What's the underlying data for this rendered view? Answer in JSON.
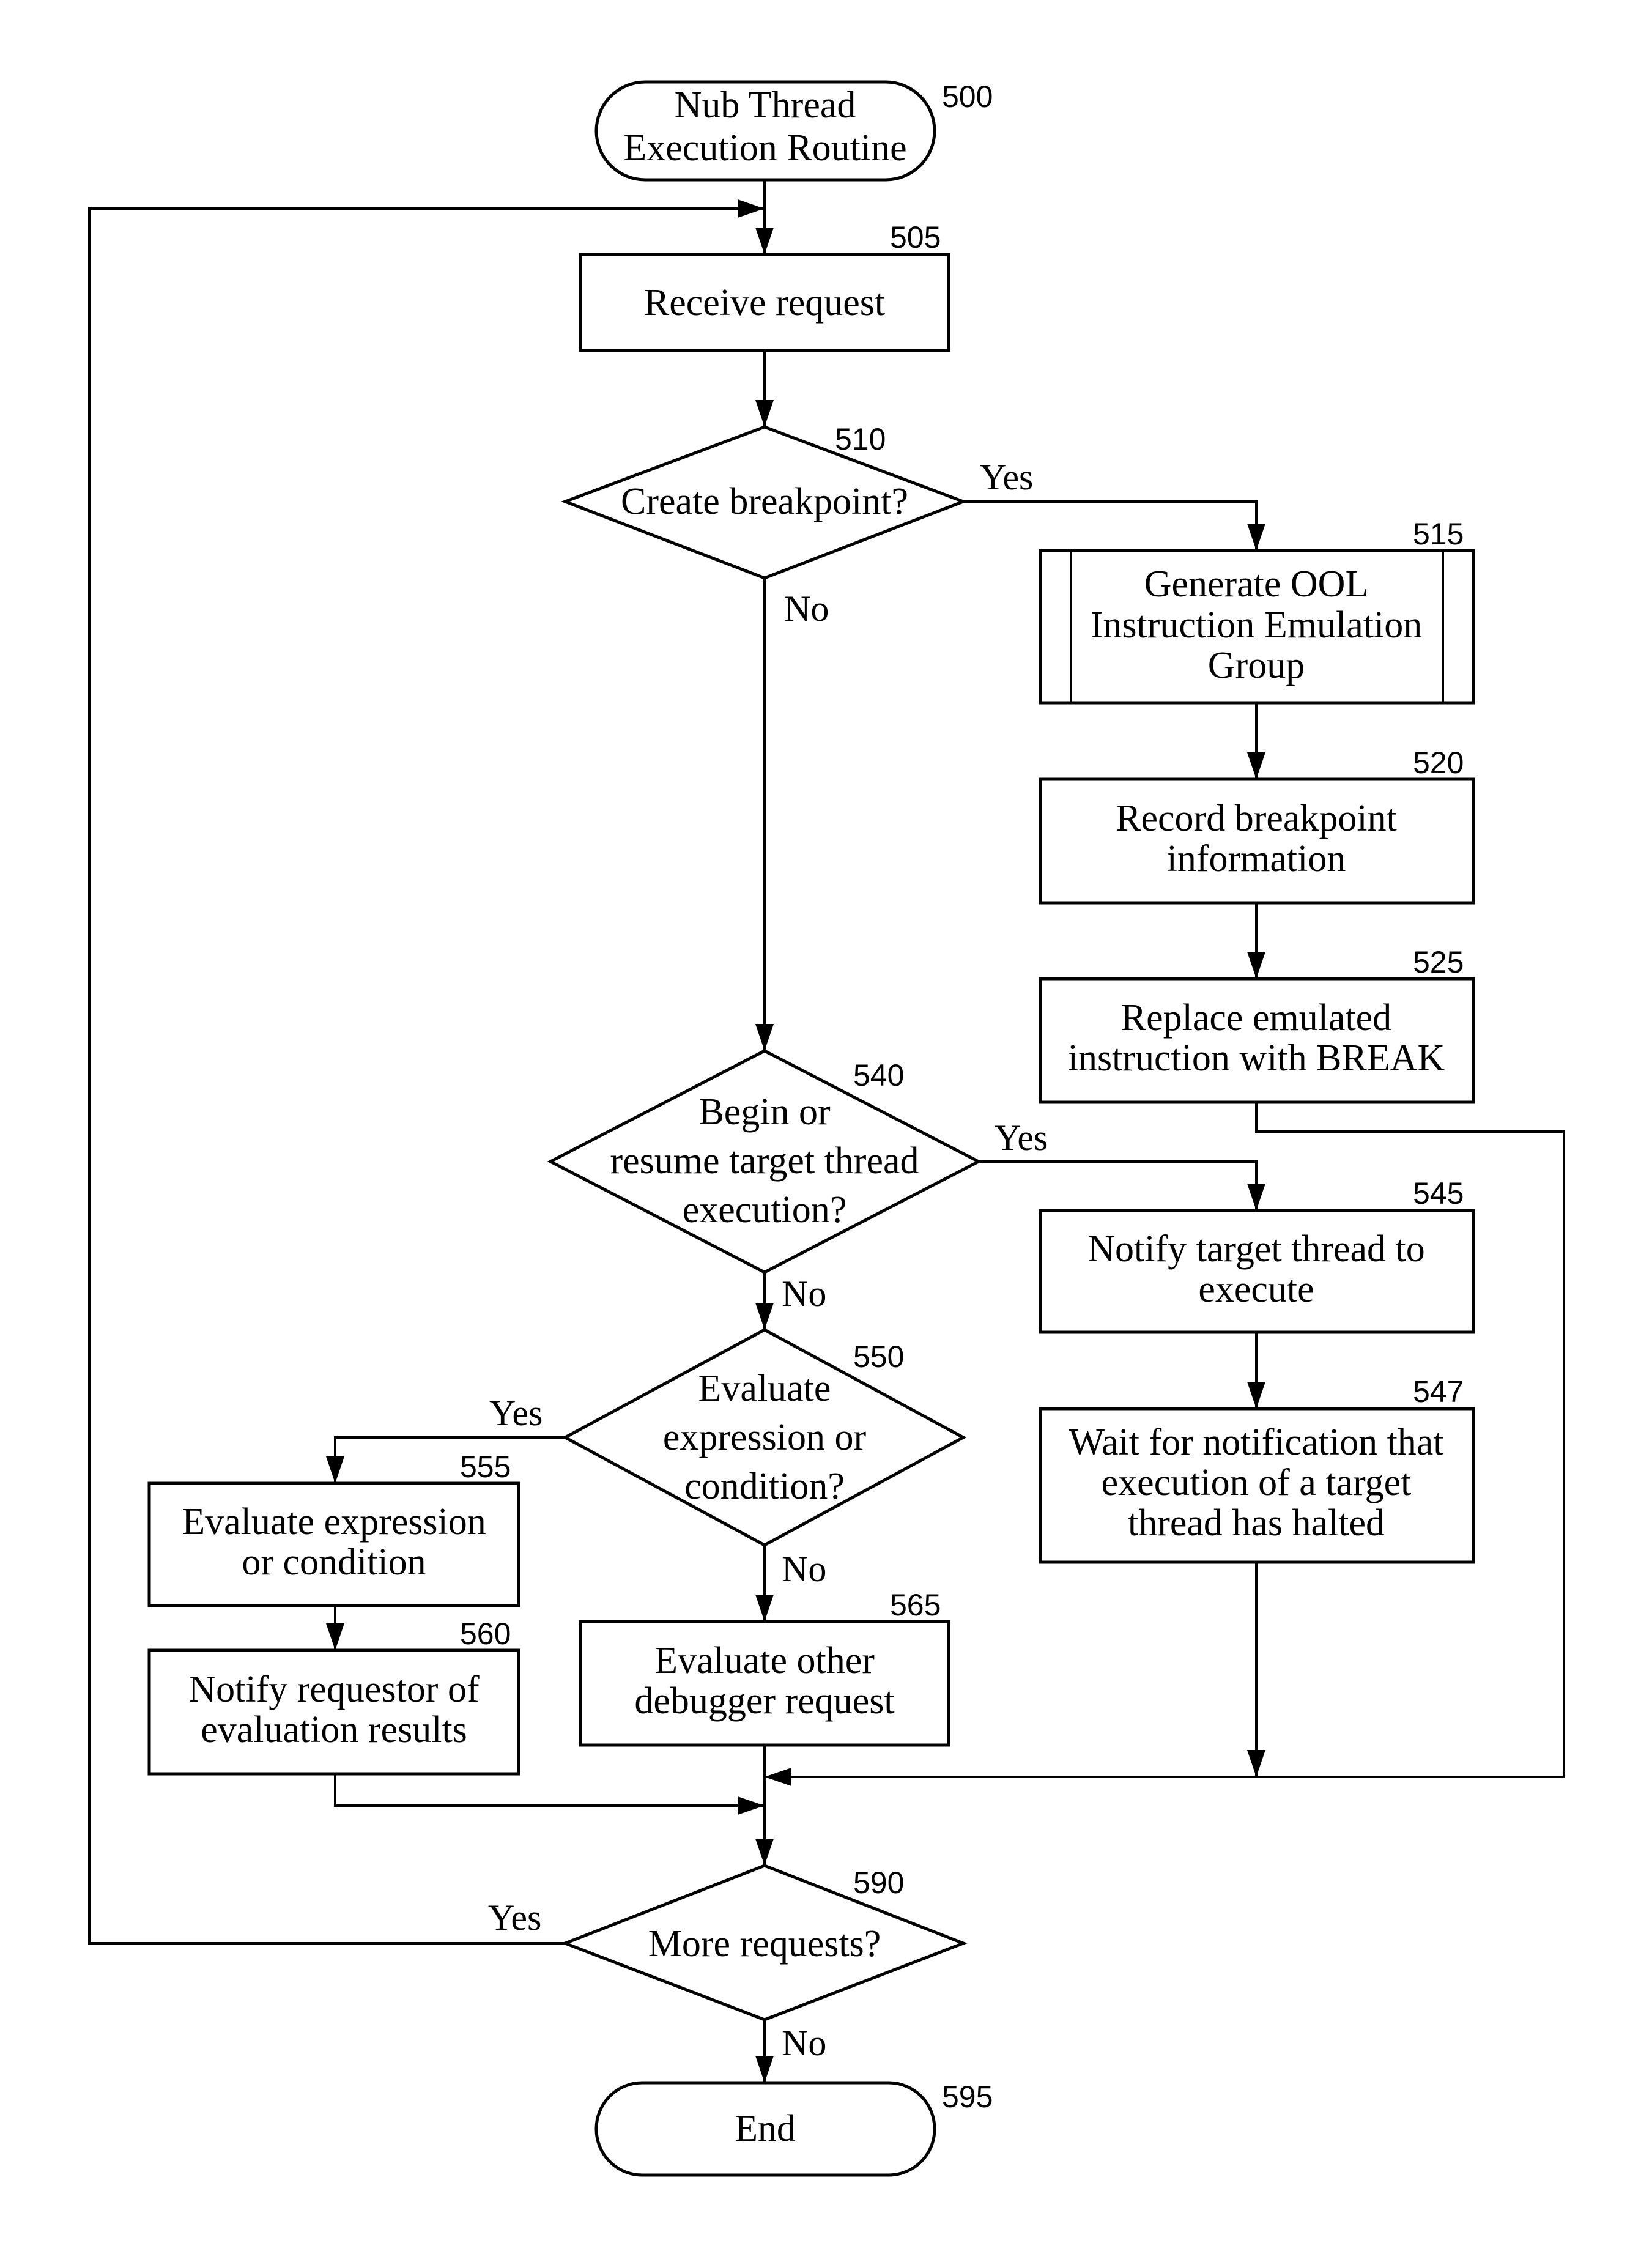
{
  "figure": {
    "nodes": {
      "n500": {
        "ref": "500",
        "type": "terminal",
        "lines": [
          "Nub Thread",
          "Execution Routine"
        ]
      },
      "n505": {
        "ref": "505",
        "type": "process",
        "lines": [
          "Receive request"
        ]
      },
      "n510": {
        "ref": "510",
        "type": "decision",
        "lines": [
          "Create breakpoint?"
        ]
      },
      "n515": {
        "ref": "515",
        "type": "predefined-process",
        "lines": [
          "Generate OOL",
          "Instruction Emulation",
          "Group"
        ]
      },
      "n520": {
        "ref": "520",
        "type": "process",
        "lines": [
          "Record breakpoint",
          "information"
        ]
      },
      "n525": {
        "ref": "525",
        "type": "process",
        "lines": [
          "Replace emulated",
          "instruction with BREAK"
        ]
      },
      "n540": {
        "ref": "540",
        "type": "decision",
        "lines": [
          "Begin or",
          "resume target thread",
          "execution?"
        ]
      },
      "n545": {
        "ref": "545",
        "type": "process",
        "lines": [
          "Notify target thread to",
          "execute"
        ]
      },
      "n547": {
        "ref": "547",
        "type": "process",
        "lines": [
          "Wait for notification that",
          "execution of a target",
          "thread has halted"
        ]
      },
      "n550": {
        "ref": "550",
        "type": "decision",
        "lines": [
          "Evaluate",
          "expression or",
          "condition?"
        ]
      },
      "n555": {
        "ref": "555",
        "type": "process",
        "lines": [
          "Evaluate expression",
          "or condition"
        ]
      },
      "n560": {
        "ref": "560",
        "type": "process",
        "lines": [
          "Notify requestor of",
          "evaluation results"
        ]
      },
      "n565": {
        "ref": "565",
        "type": "process",
        "lines": [
          "Evaluate other",
          "debugger request"
        ]
      },
      "n590": {
        "ref": "590",
        "type": "decision",
        "lines": [
          "More requests?"
        ]
      },
      "n595": {
        "ref": "595",
        "type": "terminal",
        "lines": [
          "End"
        ]
      }
    },
    "branch_labels": {
      "b510_yes": "Yes",
      "b510_no": "No",
      "b540_yes": "Yes",
      "b540_no": "No",
      "b550_yes": "Yes",
      "b550_no": "No",
      "b590_yes": "Yes",
      "b590_no": "No"
    }
  }
}
